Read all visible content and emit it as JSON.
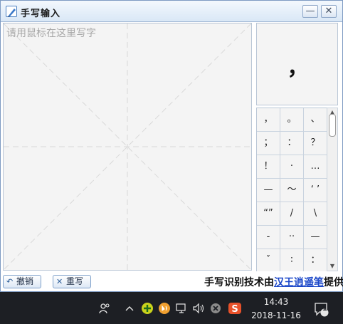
{
  "window": {
    "title": "手写输入",
    "minimize": "—",
    "close": "✕"
  },
  "pad": {
    "placeholder": "请用鼠标在这里写字"
  },
  "preview": {
    "char": "，"
  },
  "symbols": {
    "cells": [
      "，",
      "。",
      "、",
      "；",
      "：",
      "？",
      "！",
      "·",
      "…",
      "—",
      "～",
      "‘ ’",
      "“”",
      "/",
      "\\",
      "-",
      "··",
      "—",
      "ˇ",
      "∶",
      "："
    ]
  },
  "scrollbar": {
    "up": "▲",
    "down": "▼"
  },
  "bottom": {
    "undo_label": "撤销",
    "clear_label": "重写",
    "credit_prefix": "手写识别技术由",
    "credit_link": "汉王逍遥笔",
    "credit_suffix": "提供"
  },
  "taskbar": {
    "time": "14:43",
    "date": "2018-11-16",
    "notification_count": "1"
  }
}
